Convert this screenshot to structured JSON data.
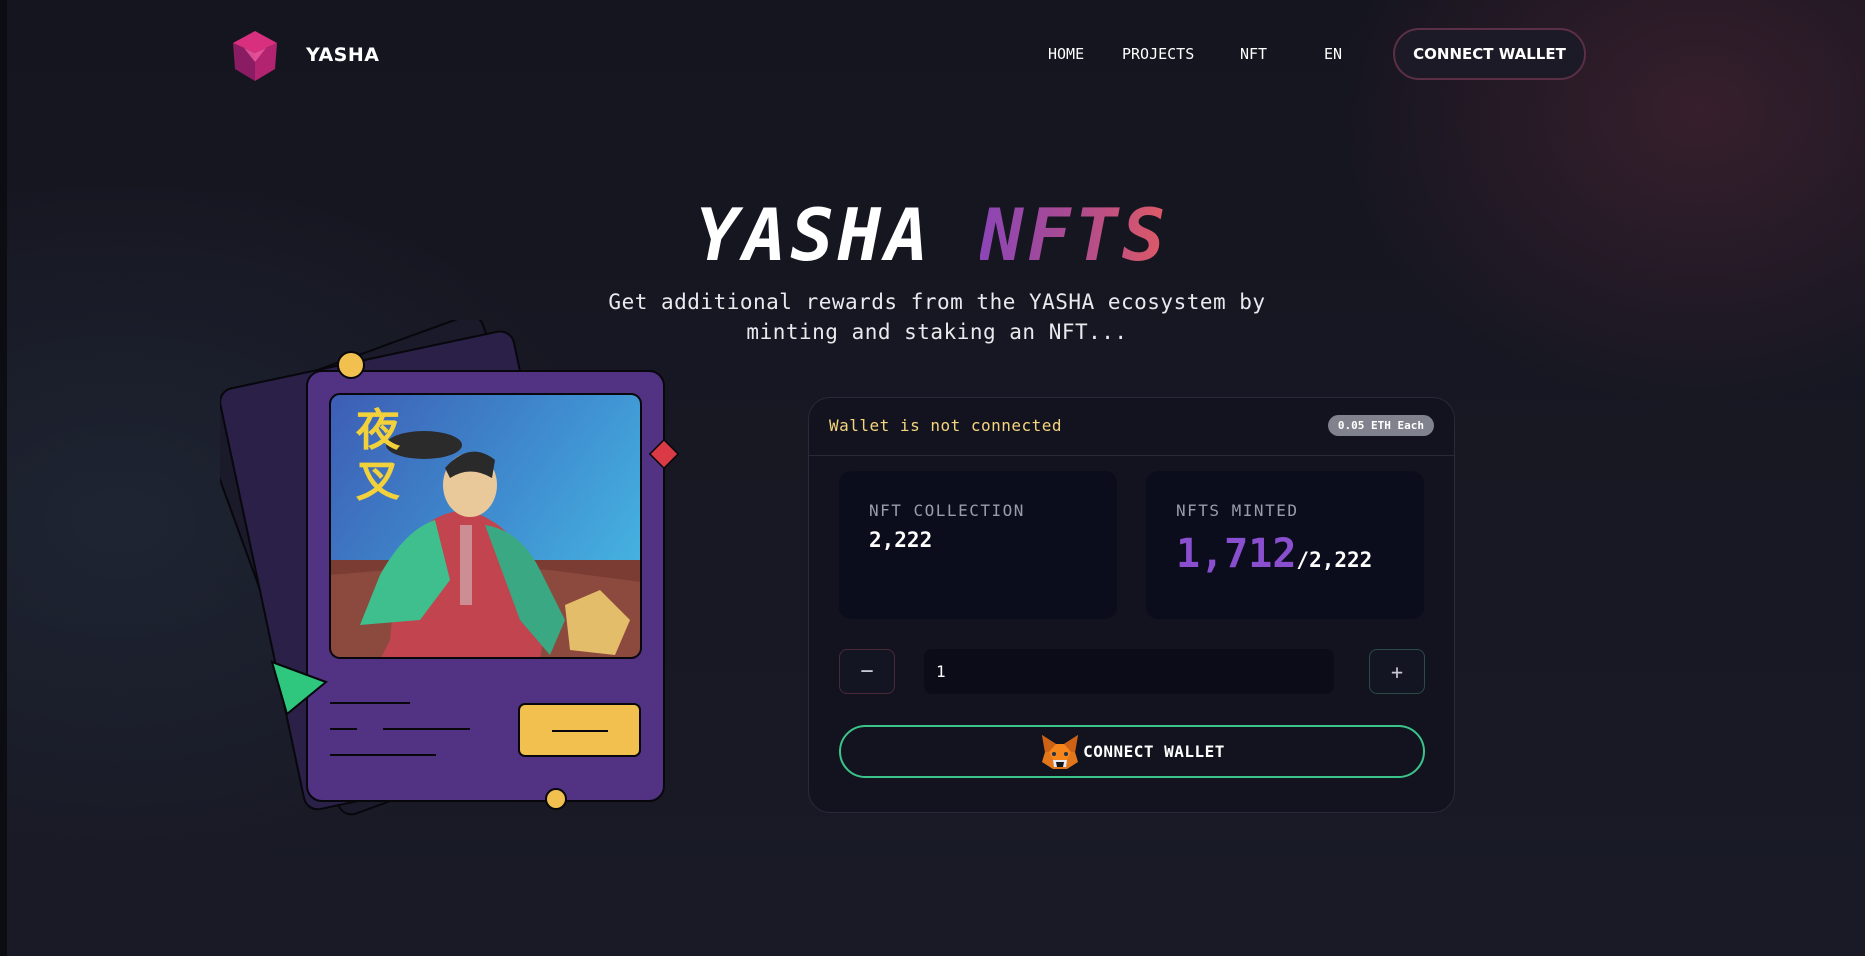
{
  "header": {
    "brand": "YASHA",
    "nav": {
      "home": "HOME",
      "projects": "PROJECTS",
      "nft": "NFT",
      "language": "EN"
    },
    "connect_button": "CONNECT WALLET"
  },
  "hero": {
    "title_part1": "YASHA",
    "title_part2": "NFTS",
    "subtitle": "Get additional rewards from the YASHA ecosystem by minting and staking an NFT..."
  },
  "card": {
    "kanji": [
      "夜",
      "叉"
    ]
  },
  "mint": {
    "wallet_status": "Wallet is not connected",
    "price_badge": "0.05 ETH Each",
    "collection_label": "NFT COLLECTION",
    "collection_value": "2,222",
    "minted_label": "NFTS MINTED",
    "minted_count": "1,712",
    "minted_total": "/2,222",
    "quantity": "1",
    "minus_label": "−",
    "plus_label": "+",
    "connect_button": "CONNECT WALLET"
  },
  "icons": {
    "logo": "cube-logo-icon",
    "wallet": "metamask-fox-icon"
  },
  "colors": {
    "background": "#171823",
    "accent_gradient": [
      "#8c46b6",
      "#e05a64"
    ],
    "wallet_status": "#f5d57d",
    "minted_accent": "#8a4fcf",
    "connect_border": "#3bc48a",
    "card_purple": "#523282",
    "card_yellow": "#f2c04f"
  }
}
